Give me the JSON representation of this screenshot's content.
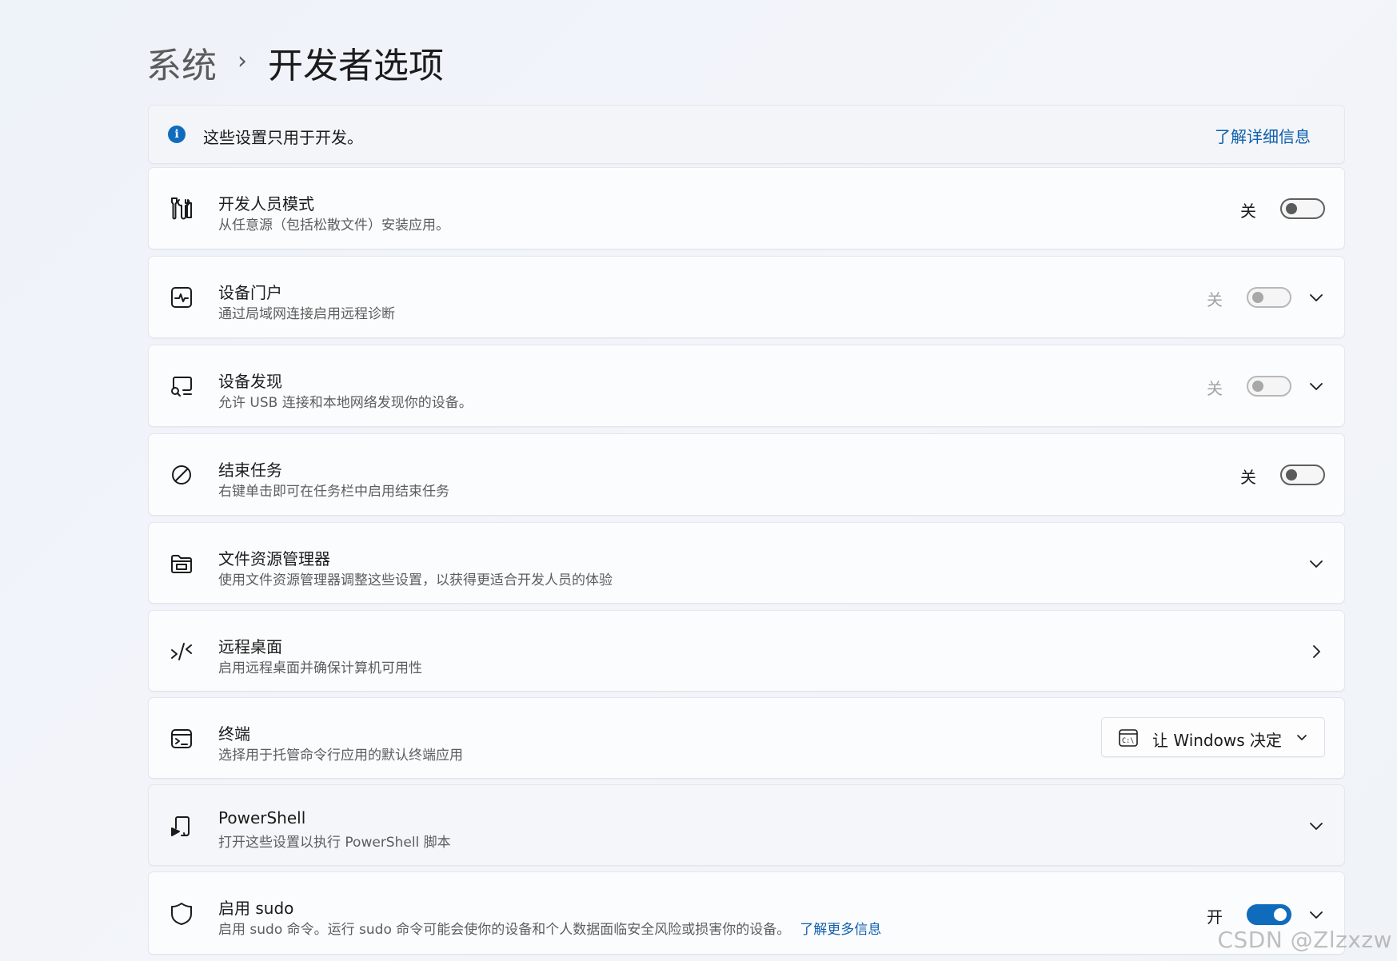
{
  "breadcrumb": {
    "parent": "系统",
    "separator": "›",
    "current": "开发者选项"
  },
  "info": {
    "icon": "info-icon",
    "text": "这些设置只用于开发。",
    "link": "了解详细信息"
  },
  "rows": [
    {
      "icon": "developer-tools-icon",
      "title": "开发人员模式",
      "subtitle": "从任意源（包括松散文件）安装应用。",
      "state": "关",
      "toggle": "off",
      "expandable": false
    },
    {
      "icon": "device-portal-icon",
      "title": "设备门户",
      "subtitle": "通过局域网连接启用远程诊断",
      "state": "关",
      "toggle": "disabled",
      "expandable": true
    },
    {
      "icon": "device-discovery-icon",
      "title": "设备发现",
      "subtitle": "允许 USB 连接和本地网络发现你的设备。",
      "state": "关",
      "toggle": "disabled",
      "expandable": true
    },
    {
      "icon": "end-task-icon",
      "title": "结束任务",
      "subtitle": "右键单击即可在任务栏中启用结束任务",
      "state": "关",
      "toggle": "off",
      "expandable": false
    },
    {
      "icon": "file-explorer-icon",
      "title": "文件资源管理器",
      "subtitle": "使用文件资源管理器调整这些设置，以获得更适合开发人员的体验",
      "expandable": true
    },
    {
      "icon": "remote-desktop-icon",
      "title": "远程桌面",
      "subtitle": "启用远程桌面并确保计算机可用性",
      "navigate": true
    },
    {
      "icon": "terminal-icon",
      "title": "终端",
      "subtitle": "选择用于托管命令行应用的默认终端应用",
      "dropdown": "让 Windows 决定",
      "dropdown_icon": "console-icon"
    },
    {
      "icon": "powershell-icon",
      "title": "PowerShell",
      "subtitle": "打开这些设置以执行 PowerShell 脚本",
      "expandable": true
    },
    {
      "icon": "shield-icon",
      "title": "启用 sudo",
      "subtitle": "启用 sudo 命令。运行 sudo 命令可能会使你的设备和个人数据面临安全风险或损害你的设备。",
      "subtitle_link": "了解更多信息",
      "state": "开",
      "toggle": "on",
      "expandable": true
    }
  ],
  "watermark": "CSDN @Zlzxzw",
  "colors": {
    "accent": "#0f6cbd",
    "link": "#0f5fad",
    "background": "#f0f3f8",
    "card": "#fbfcfd"
  }
}
